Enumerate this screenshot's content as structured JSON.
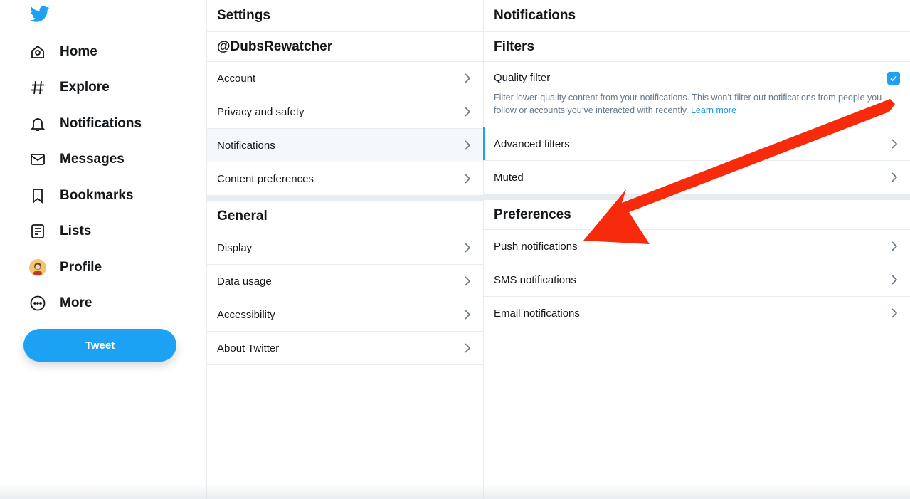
{
  "nav": {
    "items": [
      {
        "label": "Home",
        "icon": "home-icon"
      },
      {
        "label": "Explore",
        "icon": "hash-icon"
      },
      {
        "label": "Notifications",
        "icon": "bell-icon"
      },
      {
        "label": "Messages",
        "icon": "mail-icon"
      },
      {
        "label": "Bookmarks",
        "icon": "bookmark-icon"
      },
      {
        "label": "Lists",
        "icon": "list-icon"
      },
      {
        "label": "Profile",
        "icon": "avatar"
      },
      {
        "label": "More",
        "icon": "more-icon"
      }
    ],
    "tweet_label": "Tweet"
  },
  "settings": {
    "title": "Settings",
    "account_header": "@DubsRewatcher",
    "account_items": [
      "Account",
      "Privacy and safety",
      "Notifications",
      "Content preferences"
    ],
    "active_item": "Notifications",
    "general_header": "General",
    "general_items": [
      "Display",
      "Data usage",
      "Accessibility",
      "About Twitter"
    ]
  },
  "notifications": {
    "title": "Notifications",
    "filters_header": "Filters",
    "quality_filter": {
      "label": "Quality filter",
      "checked": true,
      "description": "Filter lower-quality content from your notifications. This won’t filter out notifications from people you follow or accounts you’ve interacted with recently. ",
      "link": "Learn more"
    },
    "filter_items": [
      "Advanced filters",
      "Muted"
    ],
    "preferences_header": "Preferences",
    "preference_items": [
      "Push notifications",
      "SMS notifications",
      "Email notifications"
    ]
  },
  "colors": {
    "accent": "#1da1f2",
    "annotation_arrow": "#f72a0c"
  }
}
